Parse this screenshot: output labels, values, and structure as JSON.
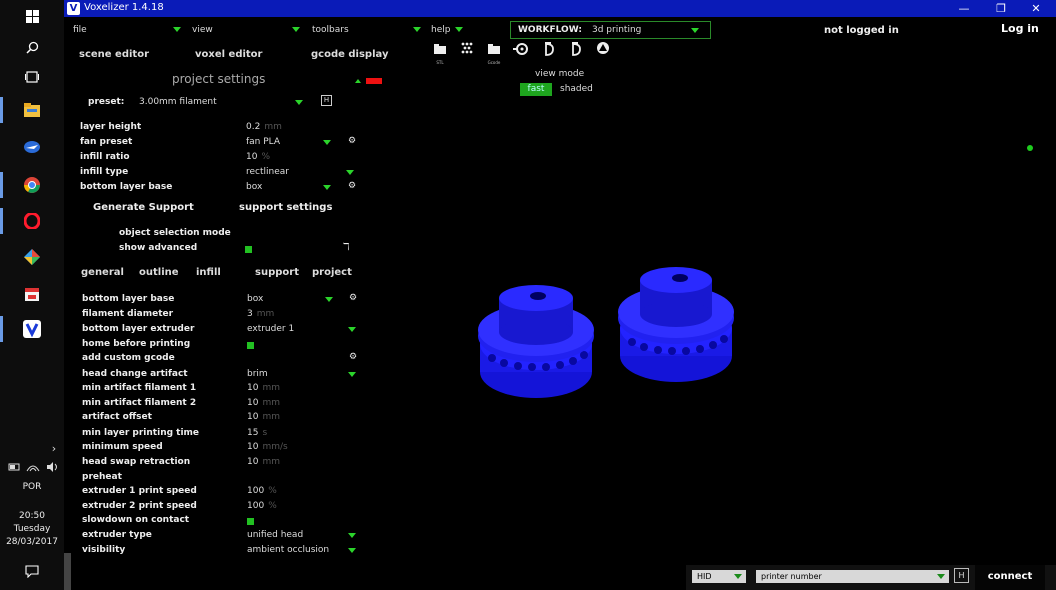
{
  "window": {
    "title": "Voxelizer 1.4.18",
    "logo_letter": "V"
  },
  "menus": {
    "file": "file",
    "view": "view",
    "toolbars": "toolbars",
    "help": "help"
  },
  "workflow": {
    "label": "WORKFLOW:",
    "value": "3d printing"
  },
  "account": {
    "status": "not logged in",
    "login": "Log in"
  },
  "toolbar_icons": [
    "stl-import-icon",
    "pattern-icon",
    "gcode-import-icon",
    "rotate-icon",
    "print-head-icon-1",
    "print-head-icon-2",
    "shape-icon"
  ],
  "toolbar_captions": {
    "stl": "STL",
    "gcode": "Gcode"
  },
  "view_mode": {
    "title": "view mode",
    "fast": "fast",
    "shaded": "shaded"
  },
  "editor_tabs": {
    "scene": "scene editor",
    "voxel": "voxel editor",
    "gcode": "gcode display"
  },
  "panel": {
    "title": "project settings"
  },
  "preset": {
    "label": "preset:",
    "value": "3.00mm filament"
  },
  "settings_top": [
    {
      "label": "layer height",
      "value": "0.2",
      "unit": "mm"
    },
    {
      "label": "fan preset",
      "value": "fan PLA"
    },
    {
      "label": "infill ratio",
      "value": "10",
      "unit": "%"
    },
    {
      "label": "infill type",
      "value": "rectlinear"
    },
    {
      "label": "bottom layer base",
      "value": "box"
    }
  ],
  "support": {
    "generate": "Generate Support",
    "settings": "support settings"
  },
  "options": {
    "object_selection_mode": "object selection mode",
    "show_advanced": "show advanced"
  },
  "sub_tabs": {
    "general": "general",
    "outline": "outline",
    "infill": "infill",
    "support": "support",
    "project": "project"
  },
  "settings_project": [
    {
      "label": "bottom layer base",
      "value": "box"
    },
    {
      "label": "filament diameter",
      "value": "3",
      "unit": "mm"
    },
    {
      "label": "bottom layer extruder",
      "value": "extruder 1"
    },
    {
      "label": "home before printing",
      "value": ""
    },
    {
      "label": "add custom gcode",
      "value": ""
    },
    {
      "label": "head change artifact",
      "value": "brim"
    },
    {
      "label": "min artifact filament 1",
      "value": "10",
      "unit": "mm"
    },
    {
      "label": "min artifact filament 2",
      "value": "10",
      "unit": "mm"
    },
    {
      "label": "artifact offset",
      "value": "10",
      "unit": "mm"
    },
    {
      "label": "min layer printing time",
      "value": "15",
      "unit": "s"
    },
    {
      "label": "minimum speed",
      "value": "10",
      "unit": "mm/s"
    },
    {
      "label": "head swap retraction",
      "value": "10",
      "unit": "mm"
    },
    {
      "label": "preheat",
      "value": ""
    },
    {
      "label": "extruder 1 print speed",
      "value": "100",
      "unit": "%"
    },
    {
      "label": "extruder 2 print speed",
      "value": "100",
      "unit": "%"
    },
    {
      "label": "slowdown on contact",
      "value": ""
    },
    {
      "label": "extruder type",
      "value": "unified head"
    },
    {
      "label": "visibility",
      "value": "ambient occlusion"
    }
  ],
  "connection": {
    "port": "HID",
    "printer": "printer number",
    "connect": "connect"
  },
  "taskbar": {
    "language": "POR",
    "time": "20:50",
    "day": "Tuesday",
    "date": "28/03/2017"
  },
  "colors": {
    "titlebar": "#0a1bb8",
    "accent_green": "#22c022",
    "model_blue": "#1f1fff"
  }
}
